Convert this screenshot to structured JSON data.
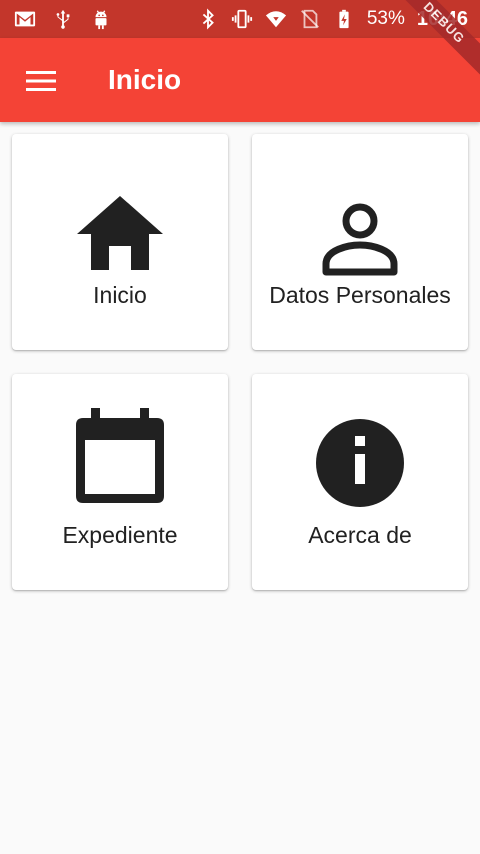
{
  "status_bar": {
    "battery_percent": "53%",
    "time": "10:46",
    "left_icons": [
      "gmail-icon",
      "usb-icon",
      "android-debug-icon"
    ],
    "right_icons": [
      "bluetooth-icon",
      "vibrate-icon",
      "wifi-icon",
      "no-sim-icon",
      "battery-charging-icon"
    ]
  },
  "app_bar": {
    "title": "Inicio",
    "menu_icon": "menu-icon",
    "color": "#f44336"
  },
  "debug_banner": "DEBUG",
  "cards": [
    {
      "label": "Inicio",
      "icon": "home-icon"
    },
    {
      "label": "Datos Personales",
      "icon": "person-icon"
    },
    {
      "label": "Expediente",
      "icon": "calendar-icon"
    },
    {
      "label": "Acerca de",
      "icon": "info-icon"
    }
  ]
}
